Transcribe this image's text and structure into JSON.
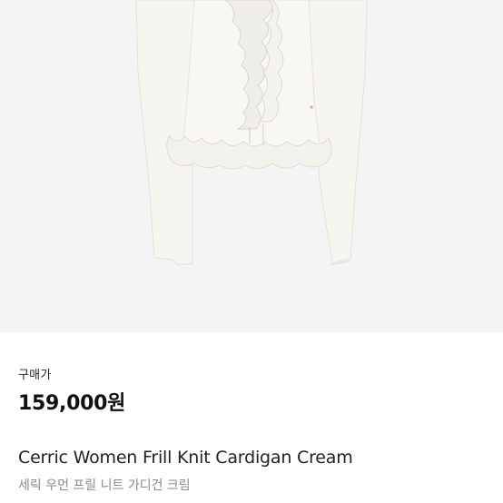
{
  "product": {
    "image_alt": "cardigan-image",
    "price_label": "구매가",
    "price": "159,000원",
    "name_en": "Cerric Women Frill Knit Cardigan Cream",
    "name_ko": "세릭 우먼 프릴 니트 가디건 크림"
  },
  "colors": {
    "image_background": "#f4f4f4",
    "garment": "#f7f6f1",
    "text_primary": "#111111",
    "text_secondary": "#8a8a8a"
  }
}
